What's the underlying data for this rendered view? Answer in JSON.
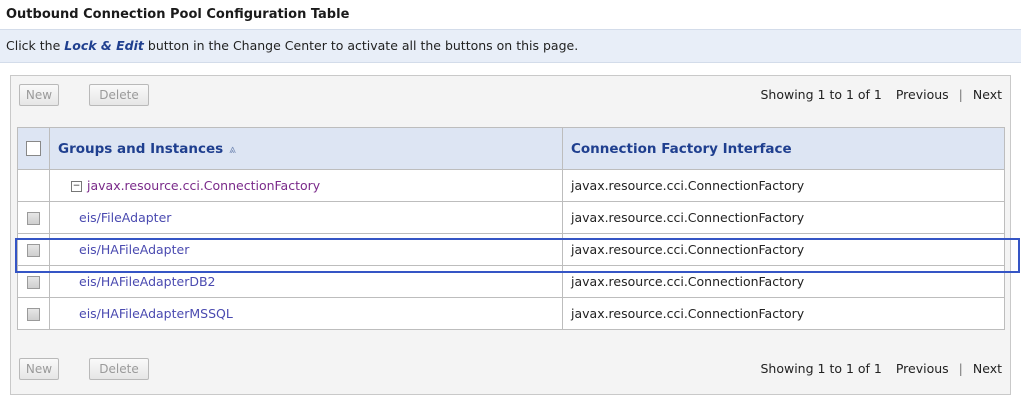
{
  "title": "Outbound Connection Pool Configuration Table",
  "info": {
    "prefix": "Click the",
    "emphasis": "Lock & Edit",
    "suffix": "button in the Change Center to activate all the buttons on this page."
  },
  "toolbar": {
    "new_label": "New",
    "delete_label": "Delete",
    "showing": "Showing 1 to 1 of 1",
    "previous": "Previous",
    "next": "Next"
  },
  "table": {
    "headers": [
      "Groups and Instances",
      "Connection Factory Interface"
    ],
    "group_row": {
      "name": "javax.resource.cci.ConnectionFactory",
      "interface": "javax.resource.cci.ConnectionFactory",
      "expander": "−"
    },
    "rows": [
      {
        "name": "eis/FileAdapter",
        "interface": "javax.resource.cci.ConnectionFactory"
      },
      {
        "name": "eis/HAFileAdapter",
        "interface": "javax.resource.cci.ConnectionFactory"
      },
      {
        "name": "eis/HAFileAdapterDB2",
        "interface": "javax.resource.cci.ConnectionFactory"
      },
      {
        "name": "eis/HAFileAdapterMSSQL",
        "interface": "javax.resource.cci.ConnectionFactory"
      }
    ],
    "sort_icon": "sort-ascending-icon"
  },
  "colors": {
    "header_bg": "#dde5f3",
    "header_text": "#1f3f8f",
    "info_bg": "#e8eef8",
    "highlight": "#3555c5"
  }
}
